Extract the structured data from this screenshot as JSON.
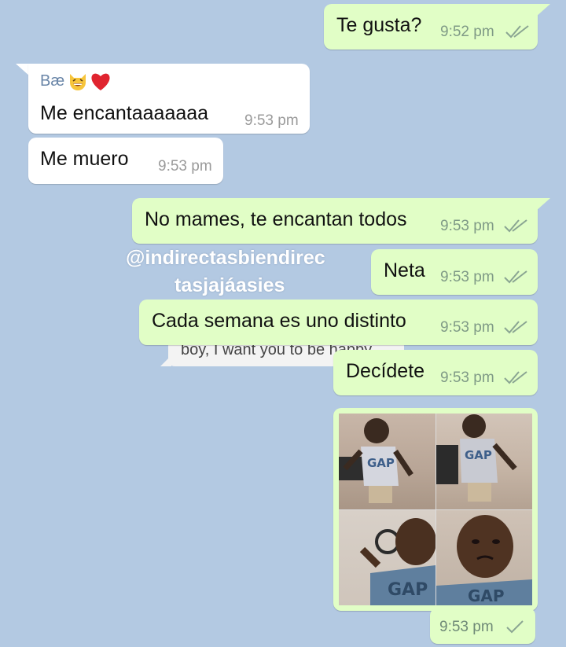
{
  "messages": [
    {
      "text": "Te gusta?",
      "time": "9:52 pm"
    },
    {
      "sender": "Bæ",
      "text": "Me encantaaaaaaa",
      "time": "9:53 pm"
    },
    {
      "text": "Me muero",
      "time": "9:53 pm"
    },
    {
      "text": "No mames, te encantan todos",
      "time": "9:53 pm"
    },
    {
      "text": "Neta",
      "time": "9:53 pm"
    },
    {
      "text": "Cada semana es uno distinto",
      "time": "9:53 pm"
    },
    {
      "text": "Decídete",
      "time": "9:53 pm"
    },
    {
      "time": "9:53 pm"
    }
  ],
  "sender_emojis": [
    "cat-grin",
    "red-heart"
  ],
  "watermark": {
    "line1": "@indirectasbiendirec",
    "line2": "tasjajáasies"
  },
  "background_quote": "boy, I want you to be happy",
  "colors": {
    "background": "#b3c9e2",
    "outgoing": "#e1fec6",
    "incoming": "#ffffff"
  }
}
